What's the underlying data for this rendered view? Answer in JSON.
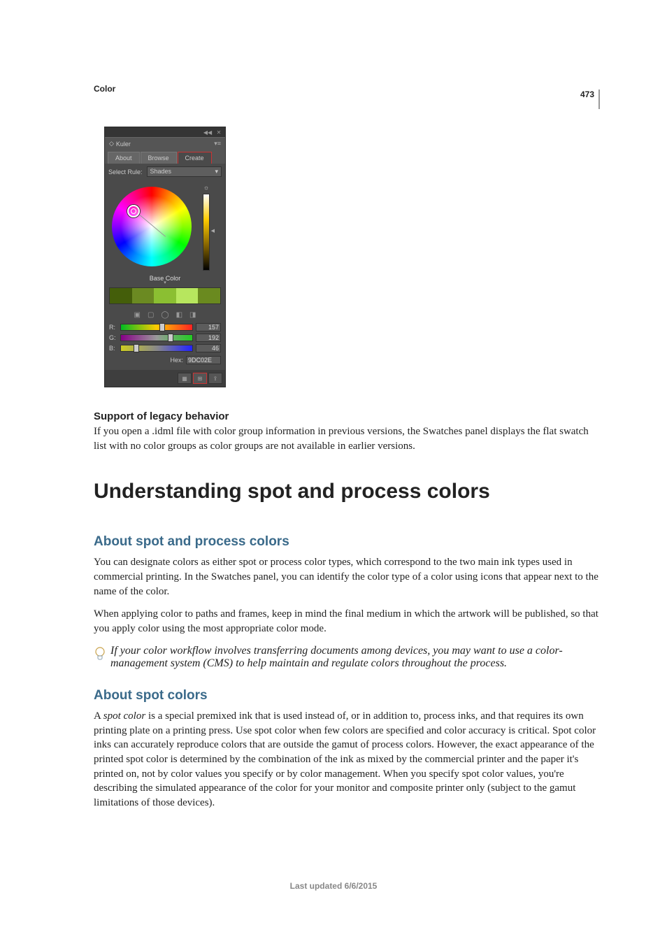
{
  "page_number": "473",
  "header": "Color",
  "last_updated": "Last updated 6/6/2015",
  "kuler": {
    "panel_title": "Kuler",
    "tabs": {
      "about": "About",
      "browse": "Browse",
      "create": "Create"
    },
    "select_rule_label": "Select Rule:",
    "select_rule_value": "Shades",
    "base_color_label": "Base Color",
    "swatches": [
      "#445e0a",
      "#6b8a22",
      "#8bbf32",
      "#b7e65e",
      "#6a8a1f"
    ],
    "rgb": {
      "r": {
        "label": "R:",
        "value": "157",
        "grad": [
          "#0b2",
          "#fc0",
          "#f22"
        ],
        "pos": "54%"
      },
      "g": {
        "label": "G:",
        "value": "192",
        "grad": [
          "#808",
          "#999",
          "#2c2"
        ],
        "pos": "66%"
      },
      "b": {
        "label": "B:",
        "value": "46",
        "grad": [
          "#cc2",
          "#888",
          "#22f"
        ],
        "pos": "18%"
      }
    },
    "hex_label": "Hex:",
    "hex_value": "9DC02E"
  },
  "sections": {
    "legacy": {
      "heading": "Support of legacy behavior",
      "body": "If you open a .idml file with color group information in previous versions, the Swatches panel displays the flat swatch list with no color groups as color groups are not available in earlier versions."
    },
    "main_heading": "Understanding spot and process colors",
    "about_both": {
      "heading": "About spot and process colors",
      "p1": "You can designate colors as either spot or process color types, which correspond to the two main ink types used in commercial printing. In the Swatches panel, you can identify the color type of a color using icons that appear next to the name of the color.",
      "p2": "When applying color to paths and frames, keep in mind the final medium in which the artwork will be published, so that you apply color using the most appropriate color mode.",
      "tip": "If your color workflow involves transferring documents among devices, you may want to use a color-management system (CMS) to help maintain and regulate colors throughout the process."
    },
    "about_spot": {
      "heading": "About spot colors",
      "p1_before": "A ",
      "p1_em": "spot color",
      "p1_after": " is a special premixed ink that is used instead of, or in addition to, process inks, and that requires its own printing plate on a printing press. Use spot color when few colors are specified and color accuracy is critical. Spot color inks can accurately reproduce colors that are outside the gamut of process colors. However, the exact appearance of the printed spot color is determined by the combination of the ink as mixed by the commercial printer and the paper it's printed on, not by color values you specify or by color management. When you specify spot color values, you're describing the simulated appearance of the color for your monitor and composite printer only (subject to the gamut limitations of those devices)."
    }
  }
}
